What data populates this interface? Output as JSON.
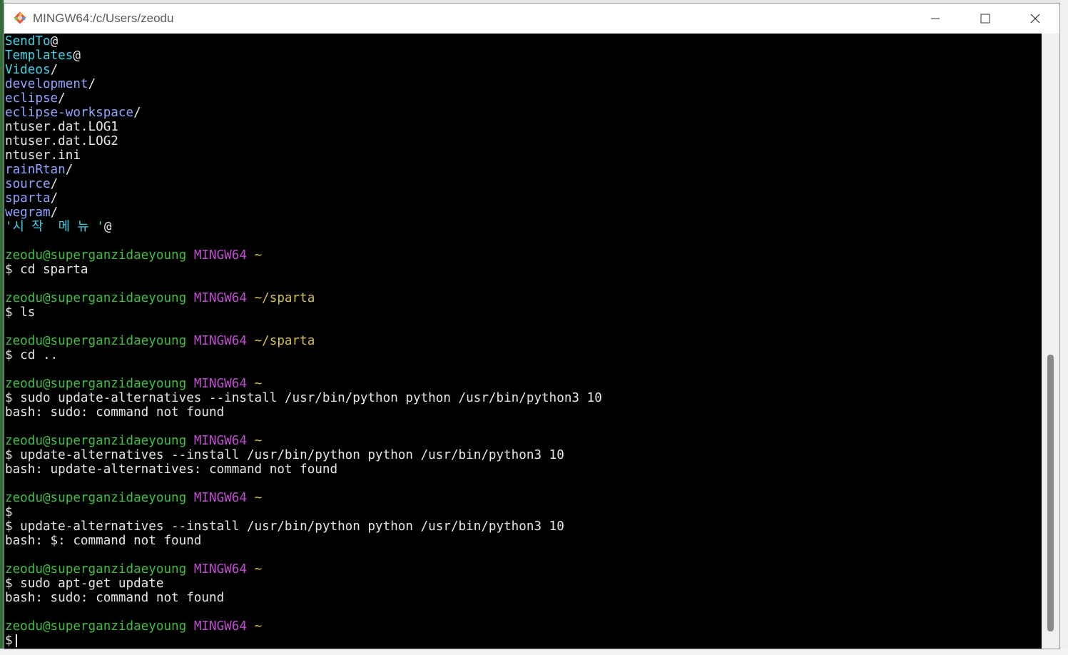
{
  "window": {
    "title": "MINGW64:/c/Users/zeodu",
    "minimize_icon": "minimize-icon",
    "maximize_icon": "maximize-icon",
    "close_icon": "close-icon"
  },
  "colors": {
    "dir": "#8fa4ff",
    "symlink": "#3fd4e8",
    "user": "#3fbf3f",
    "shell": "#c14fd1",
    "path": "#d7c04a",
    "text": "#e6e6e6"
  },
  "terminal": {
    "lines": [
      [
        {
          "t": "SendTo",
          "c": "cyan"
        },
        {
          "t": "@",
          "c": "white"
        }
      ],
      [
        {
          "t": "Templates",
          "c": "cyan"
        },
        {
          "t": "@",
          "c": "white"
        }
      ],
      [
        {
          "t": "Videos",
          "c": "cyan"
        },
        {
          "t": "/",
          "c": "white"
        }
      ],
      [
        {
          "t": "development",
          "c": "blue"
        },
        {
          "t": "/",
          "c": "white"
        }
      ],
      [
        {
          "t": "eclipse",
          "c": "blue"
        },
        {
          "t": "/",
          "c": "white"
        }
      ],
      [
        {
          "t": "eclipse-workspace",
          "c": "blue"
        },
        {
          "t": "/",
          "c": "white"
        }
      ],
      [
        {
          "t": "ntuser.dat.LOG1",
          "c": "white"
        }
      ],
      [
        {
          "t": "ntuser.dat.LOG2",
          "c": "white"
        }
      ],
      [
        {
          "t": "ntuser.ini",
          "c": "white"
        }
      ],
      [
        {
          "t": "rainRtan",
          "c": "blue"
        },
        {
          "t": "/",
          "c": "white"
        }
      ],
      [
        {
          "t": "source",
          "c": "blue"
        },
        {
          "t": "/",
          "c": "white"
        }
      ],
      [
        {
          "t": "sparta",
          "c": "blue"
        },
        {
          "t": "/",
          "c": "white"
        }
      ],
      [
        {
          "t": "wegram",
          "c": "blue"
        },
        {
          "t": "/",
          "c": "white"
        }
      ],
      [
        {
          "t": "'시 작  메 뉴 '",
          "c": "cyan"
        },
        {
          "t": "@",
          "c": "white"
        }
      ],
      [],
      [
        {
          "t": "zeodu@superganzidaeyoung",
          "c": "green"
        },
        {
          "t": " ",
          "c": "white"
        },
        {
          "t": "MINGW64",
          "c": "magenta"
        },
        {
          "t": " ",
          "c": "white"
        },
        {
          "t": "~",
          "c": "yellow"
        }
      ],
      [
        {
          "t": "$ cd sparta",
          "c": "white"
        }
      ],
      [],
      [
        {
          "t": "zeodu@superganzidaeyoung",
          "c": "green"
        },
        {
          "t": " ",
          "c": "white"
        },
        {
          "t": "MINGW64",
          "c": "magenta"
        },
        {
          "t": " ",
          "c": "white"
        },
        {
          "t": "~/sparta",
          "c": "yellow"
        }
      ],
      [
        {
          "t": "$ ls",
          "c": "white"
        }
      ],
      [],
      [
        {
          "t": "zeodu@superganzidaeyoung",
          "c": "green"
        },
        {
          "t": " ",
          "c": "white"
        },
        {
          "t": "MINGW64",
          "c": "magenta"
        },
        {
          "t": " ",
          "c": "white"
        },
        {
          "t": "~/sparta",
          "c": "yellow"
        }
      ],
      [
        {
          "t": "$ cd ..",
          "c": "white"
        }
      ],
      [],
      [
        {
          "t": "zeodu@superganzidaeyoung",
          "c": "green"
        },
        {
          "t": " ",
          "c": "white"
        },
        {
          "t": "MINGW64",
          "c": "magenta"
        },
        {
          "t": " ",
          "c": "white"
        },
        {
          "t": "~",
          "c": "yellow"
        }
      ],
      [
        {
          "t": "$ sudo update-alternatives --install /usr/bin/python python /usr/bin/python3 10",
          "c": "white"
        }
      ],
      [
        {
          "t": "bash: sudo: command not found",
          "c": "white"
        }
      ],
      [],
      [
        {
          "t": "zeodu@superganzidaeyoung",
          "c": "green"
        },
        {
          "t": " ",
          "c": "white"
        },
        {
          "t": "MINGW64",
          "c": "magenta"
        },
        {
          "t": " ",
          "c": "white"
        },
        {
          "t": "~",
          "c": "yellow"
        }
      ],
      [
        {
          "t": "$ update-alternatives --install /usr/bin/python python /usr/bin/python3 10",
          "c": "white"
        }
      ],
      [
        {
          "t": "bash: update-alternatives: command not found",
          "c": "white"
        }
      ],
      [],
      [
        {
          "t": "zeodu@superganzidaeyoung",
          "c": "green"
        },
        {
          "t": " ",
          "c": "white"
        },
        {
          "t": "MINGW64",
          "c": "magenta"
        },
        {
          "t": " ",
          "c": "white"
        },
        {
          "t": "~",
          "c": "yellow"
        }
      ],
      [
        {
          "t": "$",
          "c": "white"
        }
      ],
      [
        {
          "t": "$ update-alternatives --install /usr/bin/python python /usr/bin/python3 10",
          "c": "white"
        }
      ],
      [
        {
          "t": "bash: $: command not found",
          "c": "white"
        }
      ],
      [],
      [
        {
          "t": "zeodu@superganzidaeyoung",
          "c": "green"
        },
        {
          "t": " ",
          "c": "white"
        },
        {
          "t": "MINGW64",
          "c": "magenta"
        },
        {
          "t": " ",
          "c": "white"
        },
        {
          "t": "~",
          "c": "yellow"
        }
      ],
      [
        {
          "t": "$ sudo apt-get update",
          "c": "white"
        }
      ],
      [
        {
          "t": "bash: sudo: command not found",
          "c": "white"
        }
      ],
      [],
      [
        {
          "t": "zeodu@superganzidaeyoung",
          "c": "green"
        },
        {
          "t": " ",
          "c": "white"
        },
        {
          "t": "MINGW64",
          "c": "magenta"
        },
        {
          "t": " ",
          "c": "white"
        },
        {
          "t": "~",
          "c": "yellow"
        }
      ]
    ],
    "prompt_symbol": "$"
  }
}
